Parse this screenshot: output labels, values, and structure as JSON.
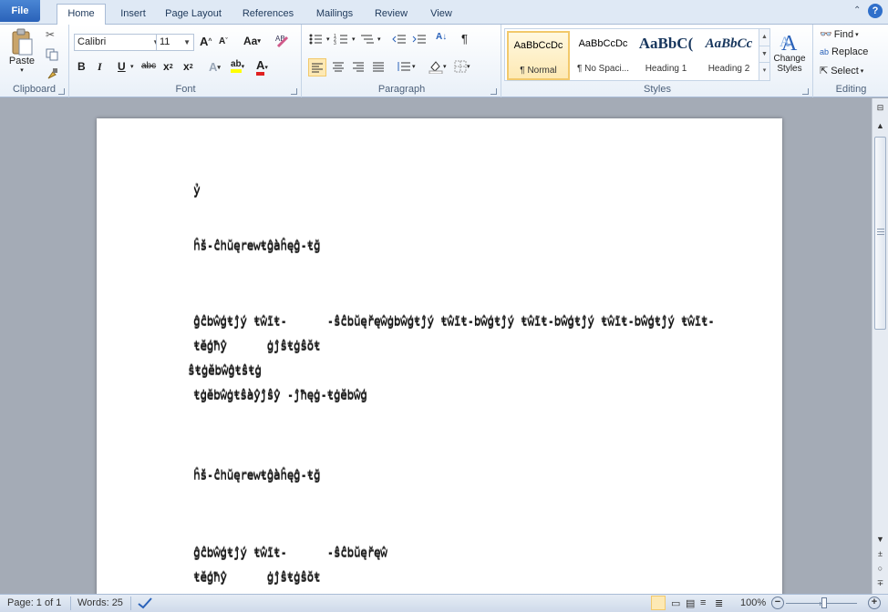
{
  "tabs": {
    "file": "File",
    "home": "Home",
    "insert": "Insert",
    "page_layout": "Page Layout",
    "references": "References",
    "mailings": "Mailings",
    "review": "Review",
    "view": "View"
  },
  "ribbon": {
    "clipboard": {
      "label": "Clipboard",
      "paste": "Paste"
    },
    "font": {
      "label": "Font",
      "family": "Calibri",
      "size": "11",
      "bold": "B",
      "italic": "I",
      "underline": "U",
      "strike": "abc",
      "subscript": "x",
      "superscript": "x",
      "grow": "A",
      "shrink": "A",
      "change_case": "Aa",
      "font_color": "A",
      "highlight": "ab"
    },
    "paragraph": {
      "label": "Paragraph",
      "sort": "A↓",
      "pilcrow": "¶"
    },
    "styles": {
      "label": "Styles",
      "items": [
        {
          "sample": "AaBbCcDc",
          "name": "¶ Normal"
        },
        {
          "sample": "AaBbCcDc",
          "name": "¶ No Spaci..."
        },
        {
          "sample": "AaBbC(",
          "name": "Heading 1"
        },
        {
          "sample": "AaBbCc",
          "name": "Heading 2"
        }
      ],
      "change_styles": "Change Styles"
    },
    "editing": {
      "label": "Editing",
      "find": "Find",
      "replace": "Replace",
      "select": "Select"
    }
  },
  "document": {
    "lines": [
      "ỷ",
      "ĥš-ĉhŭęrewŧĝàĥęĝ-ŧğ",
      "ĝĉbŵģŧĵý ŧŵĩŧ-      -ŝĉbŭęřęŵġbŵģŧĵý ŧŵĩŧ-bŵģŧĵý ŧŵĩŧ-bŵģŧĵý ŧŵĩŧ-bŵģŧĵý ŧŵĩŧ-",
      "ŧĕģħŷ      ġĵŝŧġŝŏŧ",
      "ŝŧġĕbŵĝŧŝŧġ",
      "ŧġĕbŵġŧŝàŷĵŝŷ -ĵħęġ-ŧġĕbŵģ",
      "ĥš-ĉhŭęrewŧĝàĥęĝ-ŧğ",
      "ĝĉbŵģŧĵý ŧŵĩŧ-      -ŝĉbŭęřęŵ",
      "ŧĕģħŷ      ġĵŝŧġŝŏŧ"
    ]
  },
  "status": {
    "page": "Page: 1 of 1",
    "words": "Words: 25",
    "zoom": "100%"
  }
}
